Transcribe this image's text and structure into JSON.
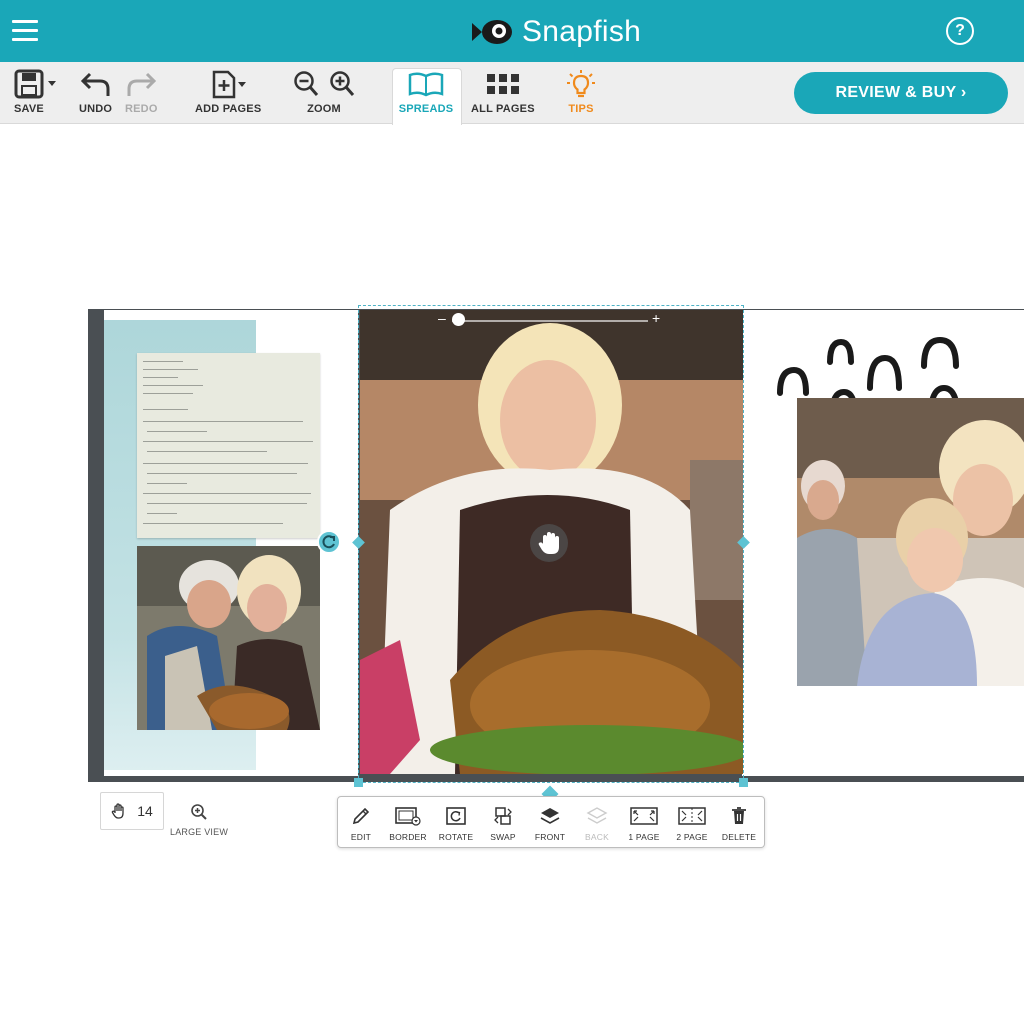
{
  "app": {
    "brand": "Snapfish",
    "colors": {
      "primary": "#1aa7b8",
      "accent": "#f08a1c",
      "toolbar": "#eeeeee",
      "selection": "#5ec3d3"
    }
  },
  "header": {
    "menu_icon": "hamburger-icon",
    "logo_icon": "fish-icon",
    "help_icon": "question-icon",
    "help_glyph": "?"
  },
  "toolbar": {
    "save": "SAVE",
    "undo": "UNDO",
    "redo": "REDO",
    "add_pages": "ADD PAGES",
    "zoom": "ZOOM",
    "spreads": "SPREADS",
    "all_pages": "ALL PAGES",
    "tips": "TIPS",
    "review_buy": "REVIEW & BUY ›"
  },
  "editor": {
    "page_count": "14",
    "large_view": "LARGE VIEW",
    "slider_minus": "–",
    "slider_plus": "+"
  },
  "context_menu": {
    "items": [
      {
        "label": "EDIT",
        "icon": "pencil-icon"
      },
      {
        "label": "BORDER",
        "icon": "border-icon"
      },
      {
        "label": "ROTATE",
        "icon": "rotate-icon"
      },
      {
        "label": "SWAP",
        "icon": "swap-icon"
      },
      {
        "label": "FRONT",
        "icon": "layers-front-icon"
      },
      {
        "label": "BACK",
        "icon": "layers-back-icon",
        "disabled": true
      },
      {
        "label": "1 PAGE",
        "icon": "one-page-icon"
      },
      {
        "label": "2 PAGE",
        "icon": "two-page-icon"
      },
      {
        "label": "DELETE",
        "icon": "trash-icon"
      }
    ]
  }
}
